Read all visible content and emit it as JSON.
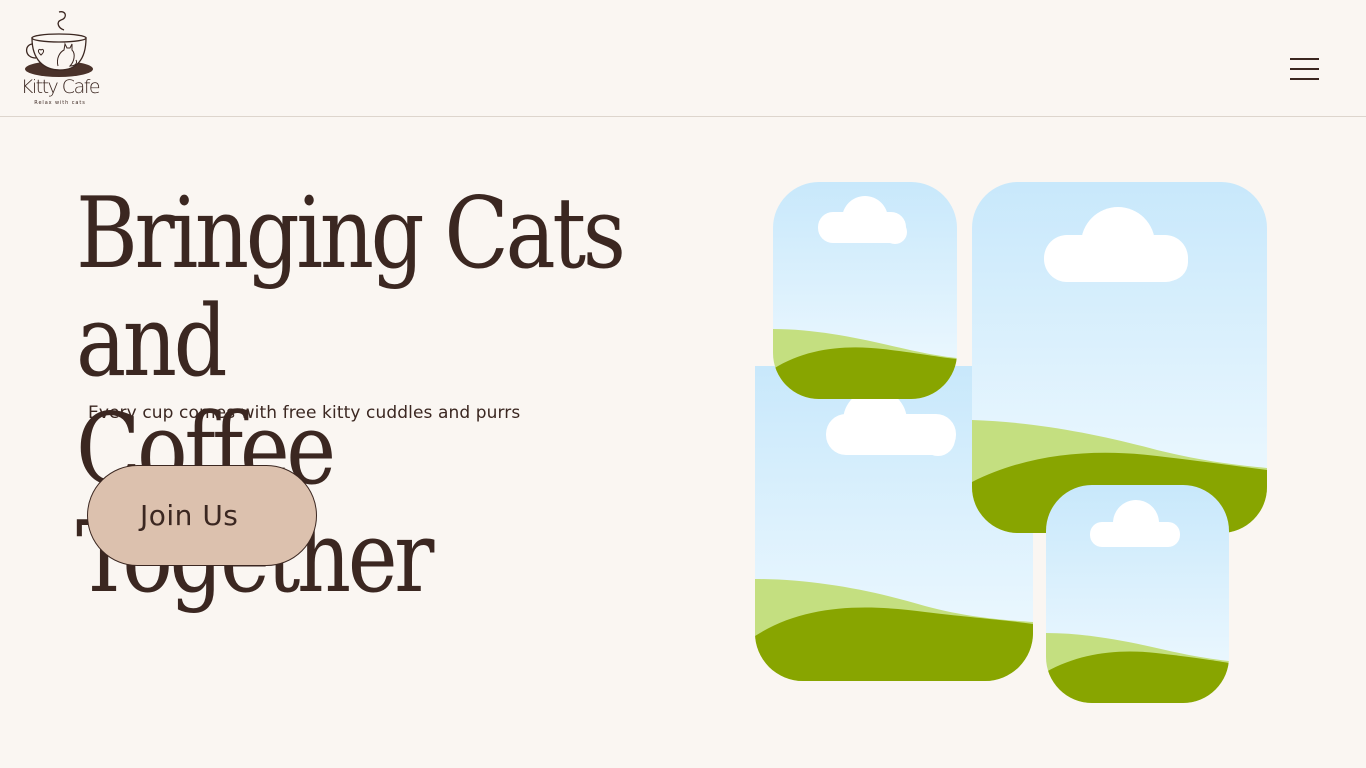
{
  "brand": {
    "name": "Kitty Cafe",
    "tagline": "Relax with cats",
    "logo_icon": "cat-in-coffee-cup-icon"
  },
  "header": {
    "menu_icon": "hamburger-menu-icon"
  },
  "hero": {
    "title_line1": "Bringing Cats and",
    "title_line2": "Coffee Together",
    "subtitle": "Every cup comes with free kitty cuddles and purrs",
    "cta_label": "Join Us"
  },
  "gallery": {
    "image_count": 4,
    "image_icon": "landscape-placeholder-icon"
  },
  "colors": {
    "background": "#faf6f2",
    "text": "#3b2721",
    "button_fill": "#dcc1ae",
    "sky_top": "#c8e8fb",
    "sky_bottom": "#f1faff",
    "hill_light": "#c4df80",
    "hill_dark": "#88a500",
    "cloud": "#ffffff"
  }
}
